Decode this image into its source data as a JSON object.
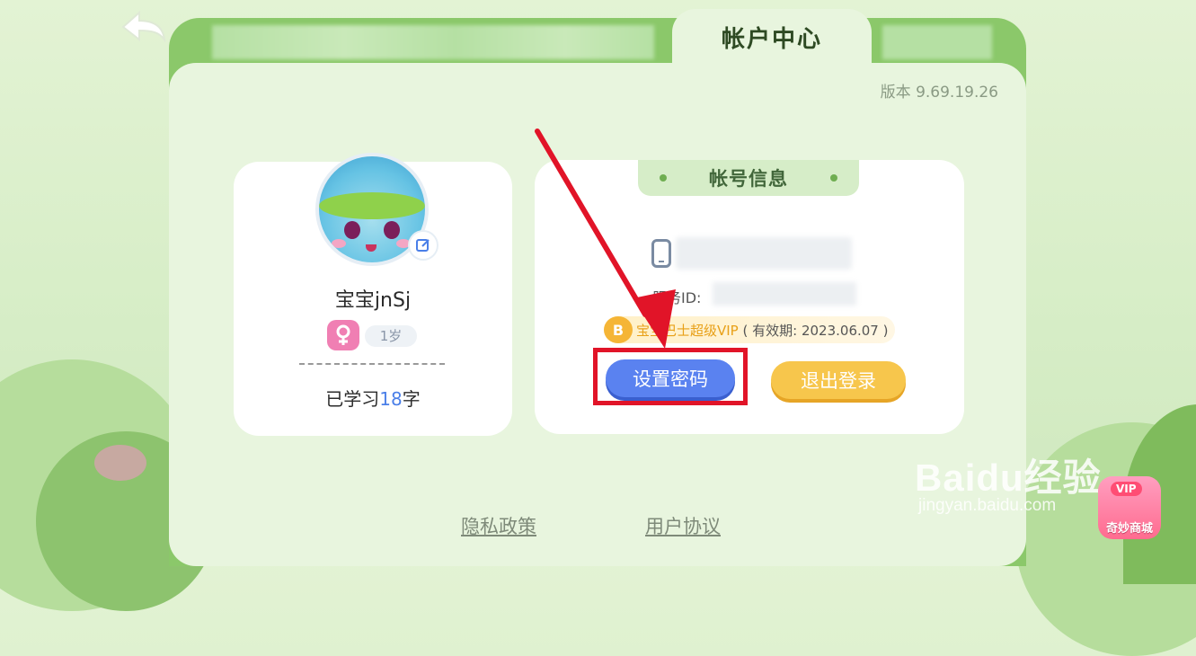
{
  "header": {
    "title": "帐户中心",
    "version": "版本 9.69.19.26"
  },
  "profile": {
    "nickname": "宝宝jnSj",
    "age": "1岁",
    "learned_prefix": "已学习",
    "learned_count": "18",
    "learned_suffix": "字"
  },
  "account": {
    "section_title": "帐号信息",
    "service_id_label": "服务ID:",
    "vip_text": "宝宝巴士超级VIP",
    "vip_expiry": "( 有效期: 2023.06.07 )",
    "set_password": "设置密码",
    "logout": "退出登录"
  },
  "footer": {
    "privacy": "隐私政策",
    "terms": "用户协议"
  },
  "shop": {
    "label": "奇妙商城",
    "badge": "VIP"
  },
  "watermark": {
    "brand": "Baidu经验",
    "url": "jingyan.baidu.com"
  },
  "colors": {
    "accent_blue": "#5a82f0",
    "accent_yellow": "#f7c64c",
    "highlight_red": "#e11428",
    "frame_green": "#8bc86a"
  }
}
